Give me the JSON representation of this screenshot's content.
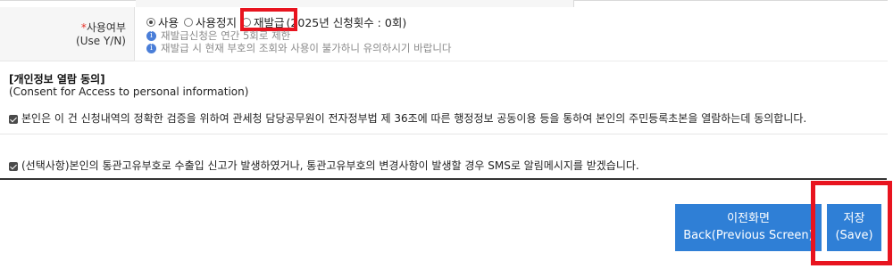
{
  "form_row": {
    "label_required_mark": "*",
    "label_ko": "사용여부",
    "label_en": "(Use Y/N)",
    "options": [
      {
        "label": "사용",
        "checked": true
      },
      {
        "label": "사용정지",
        "checked": false
      },
      {
        "label": "재발급",
        "checked": false
      }
    ],
    "apply_count_text": "(2025년 신청횟수 : 0회)",
    "info_1": "재발급신청은 연간 5회로 제한",
    "info_2": "재발급 시 현재 부호의 조회와 사용이 불가하니 유의하시기 바랍니다"
  },
  "consent": {
    "title": "[개인정보 열람 동의]",
    "subtitle": "(Consent for Access to personal information)",
    "item_1": "본인은 이 건 신청내역의 정확한 검증을 위하여 관세청 담당공무원이 전자정부법 제 36조에 따른 행정정보 공동이용 등을 통하여 본인의 주민등록초본을 열람하는데 동의합니다.",
    "item_2": "(선택사항)본인의 통관고유부호로 수출입 신고가 발생하였거나, 통관고유부호의 변경사항이 발생할 경우 SMS로 알림메시지를 받겠습니다."
  },
  "buttons": {
    "back_ko": "이전화면",
    "back_en": "Back(Previous Screen)",
    "save_ko": "저장",
    "save_en": "(Save)"
  },
  "colors": {
    "button_blue": "#2f7fd6",
    "highlight_red": "#e8141f",
    "info_icon_blue": "#4a7ed8"
  }
}
